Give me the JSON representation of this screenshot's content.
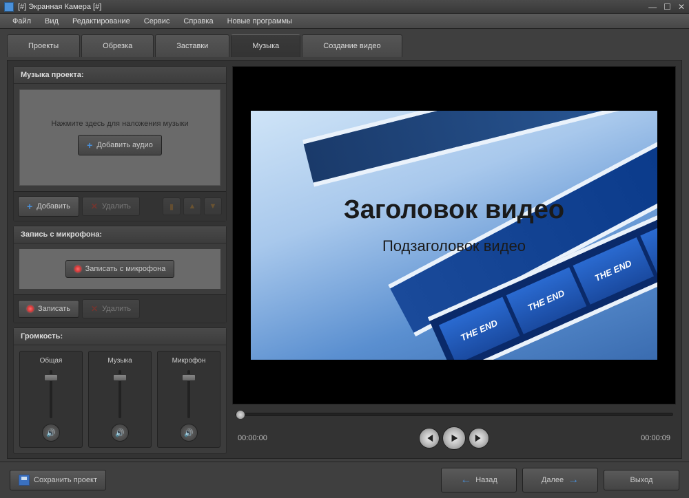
{
  "window": {
    "title": "[#] Экранная Камера [#]"
  },
  "menu": [
    "Файл",
    "Вид",
    "Редактирование",
    "Сервис",
    "Справка",
    "Новые программы"
  ],
  "tabs": [
    {
      "label": "Проекты",
      "active": false
    },
    {
      "label": "Обрезка",
      "active": false
    },
    {
      "label": "Заставки",
      "active": false
    },
    {
      "label": "Музыка",
      "active": true
    },
    {
      "label": "Создание видео",
      "active": false
    }
  ],
  "music_panel": {
    "title": "Музыка проекта:",
    "hint": "Нажмите здесь для наложения музыки",
    "add_audio_btn": "Добавить аудио",
    "add_btn": "Добавить",
    "delete_btn": "Удалить"
  },
  "mic_panel": {
    "title": "Запись с микрофона:",
    "record_from_mic_btn": "Записать с микрофона",
    "record_btn": "Записать",
    "delete_btn": "Удалить"
  },
  "volume_panel": {
    "title": "Громкость:",
    "sliders": [
      {
        "label": "Общая"
      },
      {
        "label": "Музыка"
      },
      {
        "label": "Микрофон"
      }
    ]
  },
  "preview": {
    "title_text": "Заголовок видео",
    "subtitle_text": "Подзаголовок видео",
    "frame_text": "THE END"
  },
  "playback": {
    "current": "00:00:00",
    "total": "00:00:09"
  },
  "bottom": {
    "save": "Сохранить проект",
    "back": "Назад",
    "next": "Далее",
    "exit": "Выход"
  }
}
